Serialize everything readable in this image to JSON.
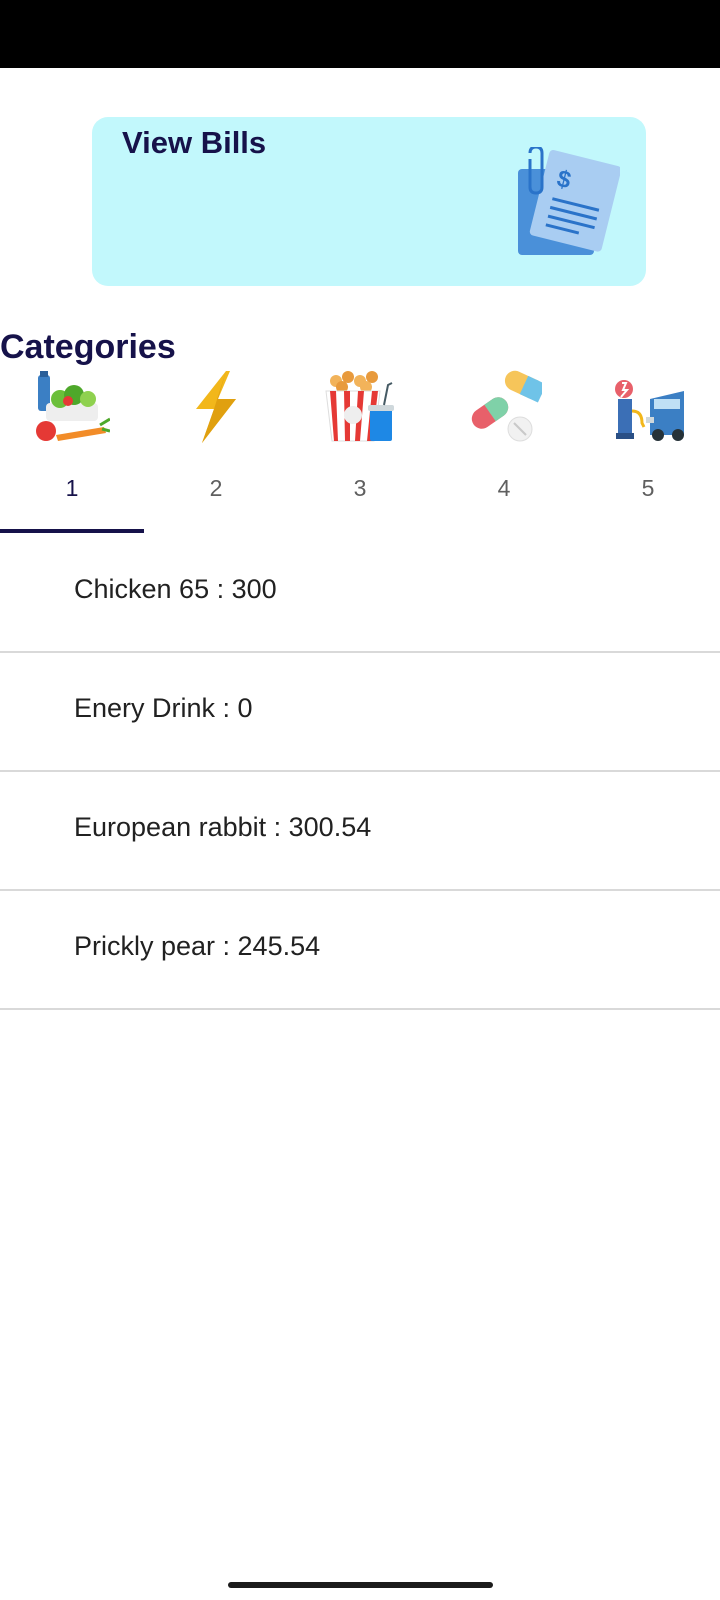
{
  "bills_card": {
    "title": "View Bills",
    "icon": "bill-document-icon"
  },
  "categories": {
    "title": "Categories",
    "tabs": [
      {
        "label": "1",
        "icon": "groceries-icon",
        "active": true
      },
      {
        "label": "2",
        "icon": "lightning-bolt-icon",
        "active": false
      },
      {
        "label": "3",
        "icon": "popcorn-drink-icon",
        "active": false
      },
      {
        "label": "4",
        "icon": "medicine-pills-icon",
        "active": false
      },
      {
        "label": "5",
        "icon": "fuel-car-icon",
        "active": false
      }
    ]
  },
  "items": [
    {
      "text": "Chicken 65 : 300"
    },
    {
      "text": "Enery Drink : 0"
    },
    {
      "text": "European rabbit : 300.54"
    },
    {
      "text": "Prickly pear : 245.54"
    }
  ],
  "colors": {
    "accent": "#16124a",
    "card_background": "#c2f8fc",
    "divider": "#d9d9d9"
  }
}
